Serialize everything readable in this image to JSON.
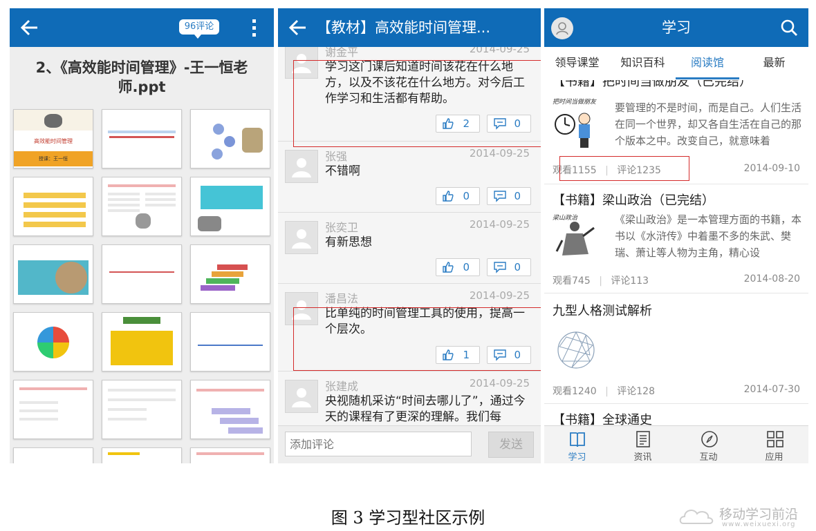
{
  "panel1": {
    "badge": "96评论",
    "doc_title": "2、《高效能时间管理》-王一恒老师.ppt",
    "slide1_title": "高效能时间管理",
    "slide1_author": "授课：王一恒"
  },
  "panel2": {
    "title": "【教材】高效能时间管理...",
    "comments": [
      {
        "name": "谢金平",
        "date": "2014-09-25",
        "text": "学习这门课后知道时间该花在什么地方，以及不该花在什么地方。对今后工作学习和生活都有帮助。",
        "likes": "2",
        "replies": "0"
      },
      {
        "name": "张强",
        "date": "2014-09-25",
        "text": "不错啊",
        "likes": "0",
        "replies": "0"
      },
      {
        "name": "张奕卫",
        "date": "2014-09-25",
        "text": "有新思想",
        "likes": "0",
        "replies": "0"
      },
      {
        "name": "潘昌法",
        "date": "2014-09-25",
        "text": "比单纯的时间管理工具的使用，提高一个层次。",
        "likes": "1",
        "replies": "0"
      },
      {
        "name": "张建成",
        "date": "2014-09-25",
        "text": "央视随机采访“时间去哪儿了”，通过今天的课程有了更深的理解。我们每",
        "likes": "",
        "replies": ""
      }
    ],
    "input_placeholder": "添加评论",
    "send_label": "发送"
  },
  "panel3": {
    "title": "学习",
    "tabs": [
      "领导课堂",
      "知识百科",
      "阅读馆",
      "最新"
    ],
    "active_tab": "阅读馆",
    "books": [
      {
        "title": "【书籍】把时间当做朋友（已完结）",
        "cover_caption": "把时间当做朋友",
        "desc": "要管理的不是时间，而是自己。人们生活在同一个世界，却又各自生活在自己的那个版本之中。改变自己，就意味着",
        "views": "观看1155",
        "comments": "评论1235",
        "date": "2014-09-10"
      },
      {
        "title": "【书籍】梁山政治（已完结）",
        "cover_caption": "梁山政治",
        "desc": "《梁山政治》是一本管理方面的书籍，本书以《水浒传》中着墨不多的朱武、樊瑞、萧让等人物为主角，精心设",
        "views": "观看745",
        "comments": "评论113",
        "date": "2014-08-20"
      },
      {
        "title": "九型人格测试解析",
        "desc": "",
        "views": "观看1240",
        "comments": "评论128",
        "date": "2014-07-30"
      },
      {
        "title": "【书籍】全球通史",
        "desc": "",
        "views": "",
        "comments": "",
        "date": ""
      }
    ],
    "nav": [
      "学习",
      "资讯",
      "互动",
      "应用"
    ],
    "accent": "#2a7cc3",
    "header_color": "#0f6bb7"
  },
  "caption": "图 3 学习型社区示例",
  "watermark": {
    "main": "移动学习前沿",
    "sub": "www.weixuexi.org"
  }
}
